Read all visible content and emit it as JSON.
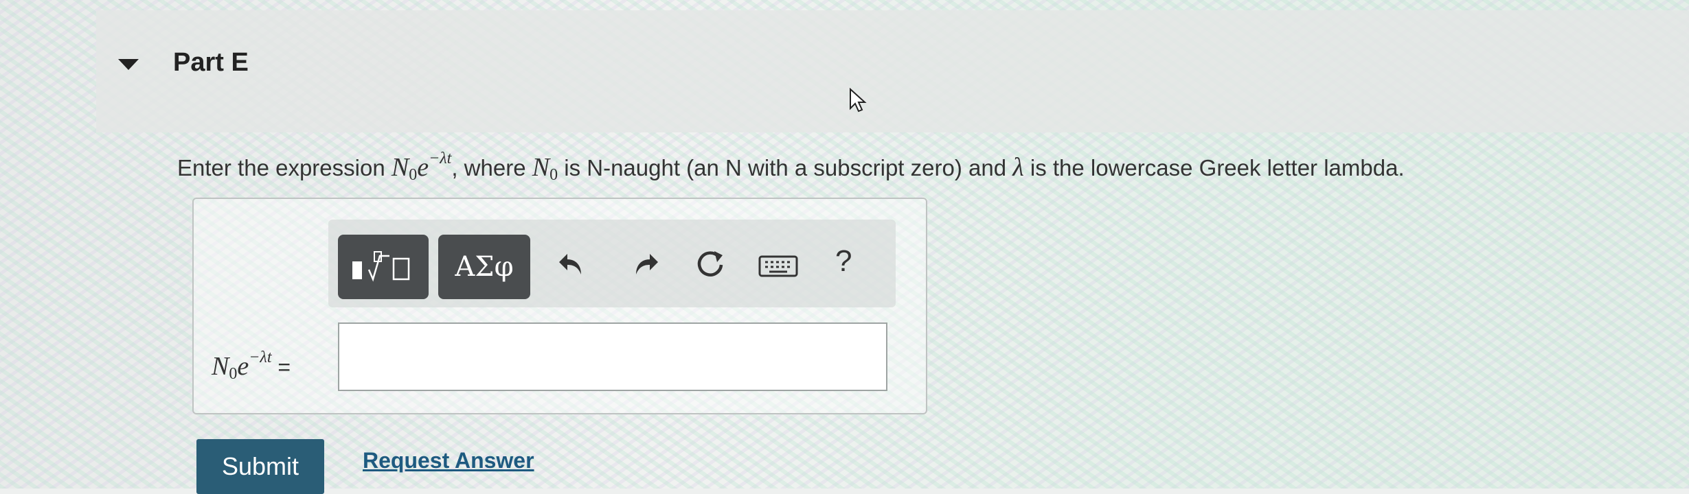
{
  "part": {
    "title": "Part E"
  },
  "instruction": {
    "text_1": "Enter the expression ",
    "text_2": ", where ",
    "text_3": " is N-naught (an N with a subscript zero) and ",
    "text_4": " is the lowercase Greek letter lambda."
  },
  "expression": {
    "base": "N",
    "sub": "0",
    "e": "e",
    "exp": "−λt",
    "lambda": "λ"
  },
  "toolbar": {
    "greek_label": "ΑΣφ",
    "help_label": "?",
    "icons": [
      "templates-icon",
      "undo-icon",
      "redo-icon",
      "reset-icon",
      "keyboard-icon"
    ]
  },
  "answer": {
    "equals": " =",
    "value": ""
  },
  "actions": {
    "submit_label": "Submit",
    "request_label": "Request Answer"
  }
}
